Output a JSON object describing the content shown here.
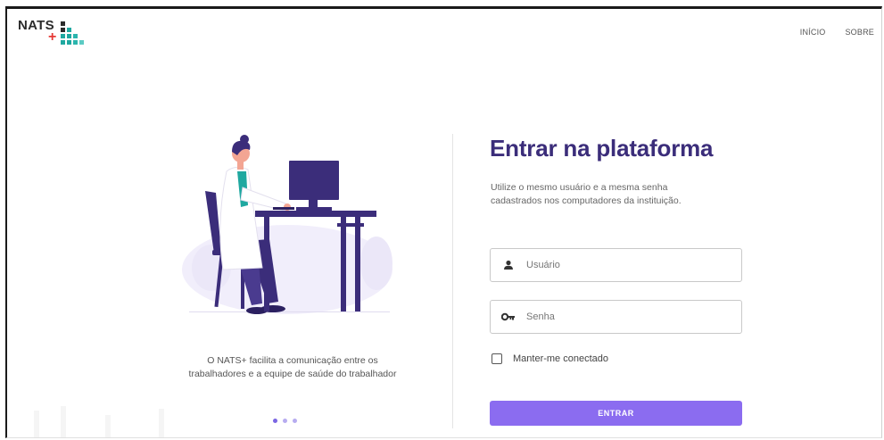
{
  "header": {
    "logo_text": "NATS",
    "logo_plus": "+",
    "nav": [
      {
        "label": "INÍCIO",
        "icon": null
      },
      {
        "label": "SOBRE",
        "icon": null
      }
    ]
  },
  "hero": {
    "caption_line1": "O NATS+ facilita a comunicação entre os",
    "caption_line2": "trabalhadores e a equipe de saúde do trabalhador",
    "carousel_dots": 3,
    "active_dot": 0
  },
  "login": {
    "title": "Entrar na plataforma",
    "subtitle_line1": "Utilize o mesmo usuário e a mesma senha",
    "subtitle_line2": "cadastrados nos computadores da instituição.",
    "username": {
      "placeholder": "Usuário",
      "value": "",
      "icon": "user-icon"
    },
    "password": {
      "placeholder": "Senha",
      "value": "",
      "icon": "key-icon"
    },
    "remember_label": "Manter-me conectado",
    "remember_checked": false,
    "submit_label": "ENTRAR"
  },
  "colors": {
    "brand_purple": "#3b2d7a",
    "button_purple": "#8b6cf0",
    "logo_red": "#e53935",
    "logo_teal": "#1fa8a0"
  }
}
